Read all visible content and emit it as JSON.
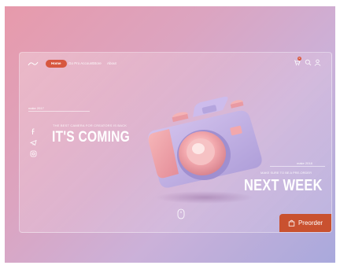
{
  "nav": {
    "home_label": "Home",
    "links": [
      "Go Pro Account",
      "Store",
      "About"
    ],
    "cart_count": "0"
  },
  "hero": {
    "left_tag": "make 2017",
    "left_subtitle": "THE BEST CAMERA FOR CREATORS IS BACK",
    "left_headline": "IT'S COMING",
    "right_tag": "make 2018",
    "right_subtitle": "MAKE SURE TO BE A PRE-ORDER",
    "right_headline": "NEXT WEEK"
  },
  "cta": {
    "preorder_label": "Preorder"
  },
  "icons": {
    "logo": "logo-icon",
    "cart": "cart-icon",
    "search": "search-icon",
    "user": "user-icon",
    "facebook": "facebook-icon",
    "telegram": "telegram-icon",
    "instagram": "instagram-icon",
    "scroll": "mouse-scroll-icon",
    "bag": "shopping-bag-icon"
  },
  "colors": {
    "accent": "#d7573f",
    "preorder": "#c9512f",
    "camera_body": "#c6b2e6",
    "camera_lens": "#f0a6ae"
  }
}
